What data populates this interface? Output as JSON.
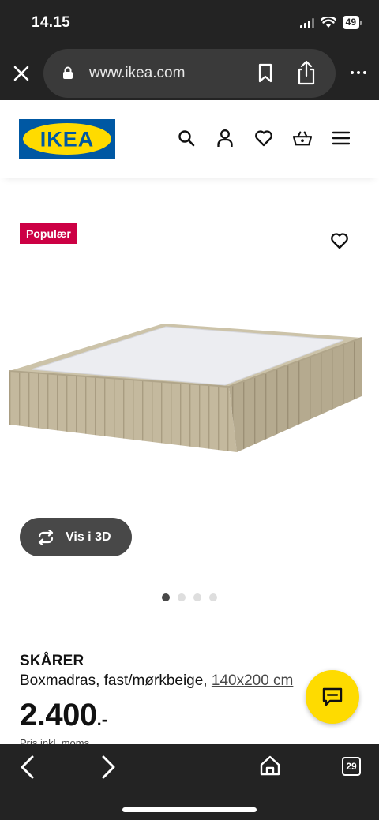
{
  "status": {
    "time": "14.15",
    "battery": "49"
  },
  "browser": {
    "url": "www.ikea.com",
    "tabs_count": "29"
  },
  "header": {
    "logo_text": "IKEA"
  },
  "product": {
    "badge": "Populær",
    "name": "SKÅRER",
    "description": "Boxmadras, fast/mørkbeige,",
    "size": "140x200 cm",
    "price_integer": "2.400",
    "price_suffix": ".-",
    "price_note": "Pris inkl. moms",
    "view3d_label": "Vis i 3D",
    "carousel": {
      "total": 4,
      "active": 1
    }
  },
  "colors": {
    "brand_blue": "#0058a3",
    "brand_yellow": "#ffdb00",
    "badge_red": "#cc0044",
    "chrome_dark": "#232323"
  },
  "icons": [
    "close-icon",
    "lock-icon",
    "bookmark-icon",
    "share-icon",
    "more-icon",
    "search-icon",
    "user-icon",
    "heart-icon",
    "basket-icon",
    "menu-icon",
    "rotate-3d-icon",
    "chat-icon",
    "back-icon",
    "forward-icon",
    "home-icon",
    "tabs-icon"
  ]
}
